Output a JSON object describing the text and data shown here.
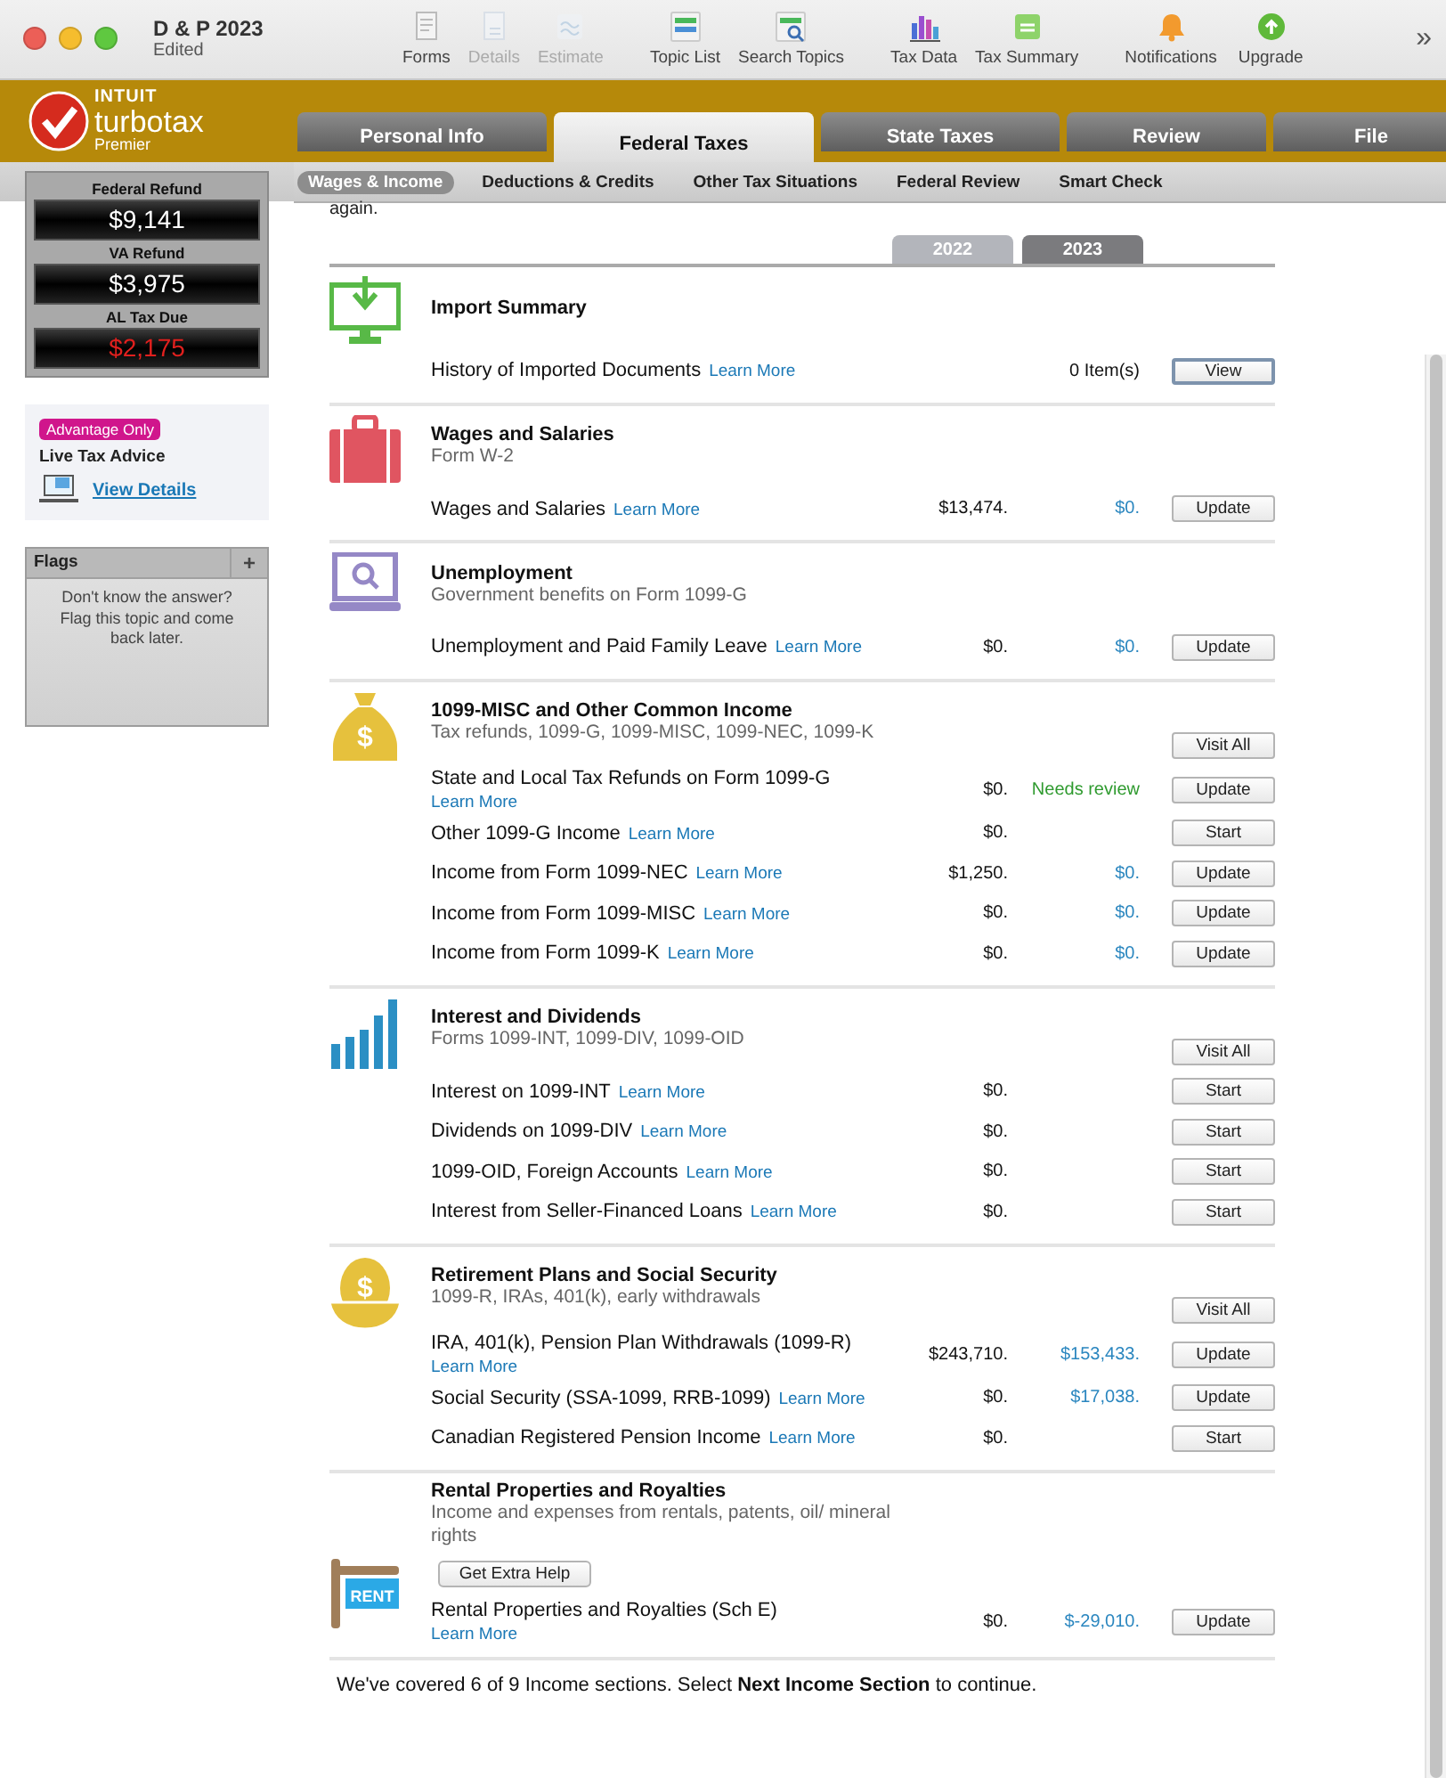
{
  "window": {
    "title": "D & P 2023",
    "subtitle": "Edited"
  },
  "toolbar": [
    {
      "label": "Forms",
      "disabled": false
    },
    {
      "label": "Details",
      "disabled": true
    },
    {
      "label": "Estimate",
      "disabled": true
    },
    {
      "label": "Topic List",
      "disabled": false
    },
    {
      "label": "Search Topics",
      "disabled": false
    },
    {
      "label": "Tax Data",
      "disabled": false
    },
    {
      "label": "Tax Summary",
      "disabled": false
    },
    {
      "label": "Notifications",
      "disabled": false
    },
    {
      "label": "Upgrade",
      "disabled": false
    }
  ],
  "toolbar_overflow": "»",
  "brand": {
    "company": "INTUIT",
    "product": "turbotax",
    "edition": "Premier"
  },
  "main_tabs": [
    {
      "label": "Personal Info",
      "selected": false
    },
    {
      "label": "Federal Taxes",
      "selected": true
    },
    {
      "label": "State Taxes",
      "selected": false
    },
    {
      "label": "Review",
      "selected": false
    },
    {
      "label": "File",
      "selected": false
    }
  ],
  "sub_tabs": [
    {
      "label": "Wages & Income",
      "selected": true
    },
    {
      "label": "Deductions & Credits",
      "selected": false
    },
    {
      "label": "Other Tax Situations",
      "selected": false
    },
    {
      "label": "Federal Review",
      "selected": false
    },
    {
      "label": "Smart Check",
      "selected": false
    }
  ],
  "refunds": [
    {
      "label": "Federal Refund",
      "amount": "$9,141",
      "kind": "refund"
    },
    {
      "label": "VA Refund",
      "amount": "$3,975",
      "kind": "refund"
    },
    {
      "label": "AL Tax Due",
      "amount": "$2,175",
      "kind": "due"
    }
  ],
  "advice_card": {
    "badge": "Advantage Only",
    "title": "Live Tax Advice",
    "link": "View Details"
  },
  "flags": {
    "title": "Flags",
    "add": "+",
    "message": "Don't know the answer? Flag this topic and come back later."
  },
  "intro_fragment": "again.",
  "year_tabs": [
    {
      "label": "2022",
      "selected": false
    },
    {
      "label": "2023",
      "selected": true
    }
  ],
  "sections": [
    {
      "title": "Import Summary",
      "rows": [
        {
          "label": "History of Imported Documents",
          "link": "Learn More",
          "current": "0 Item(s)",
          "color": "#111111",
          "button": "View",
          "focused": true
        }
      ]
    },
    {
      "title": "Wages and Salaries",
      "subtitle": "Form W-2",
      "rows": [
        {
          "label": "Wages and Salaries",
          "link": "Learn More",
          "prior": "$13,474.",
          "current": "$0.",
          "color": "#2a86bf",
          "button": "Update",
          "focused": false
        }
      ]
    },
    {
      "title": "Unemployment",
      "subtitle": "Government benefits on Form 1099-G",
      "rows": [
        {
          "label": "Unemployment and Paid Family Leave",
          "link": "Learn More",
          "prior": "$0.",
          "current": "$0.",
          "color": "#2a86bf",
          "button": "Update",
          "focused": false
        }
      ]
    },
    {
      "title": "1099-MISC and Other Common Income",
      "subtitle": "Tax refunds, 1099-G, 1099-MISC, 1099-NEC, 1099-K",
      "symbol": "$",
      "visit_all": "Visit All",
      "rows": [
        {
          "label": "State and Local Tax Refunds on Form 1099-G",
          "link": "Learn More",
          "prior": "$0.",
          "current": "Needs review",
          "color": "#2e9a2e",
          "button": "Update",
          "focused": false
        },
        {
          "label": "Other 1099-G Income",
          "link": "Learn More",
          "prior": "$0.",
          "button": "Start",
          "focused": false
        },
        {
          "label": "Income from Form 1099-NEC",
          "link": "Learn More",
          "prior": "$1,250.",
          "current": "$0.",
          "color": "#2a86bf",
          "button": "Update",
          "focused": false
        },
        {
          "label": "Income from Form 1099-MISC",
          "link": "Learn More",
          "prior": "$0.",
          "current": "$0.",
          "color": "#2a86bf",
          "button": "Update",
          "focused": false
        },
        {
          "label": "Income from Form 1099-K",
          "link": "Learn More",
          "prior": "$0.",
          "current": "$0.",
          "color": "#2a86bf",
          "button": "Update",
          "focused": false
        }
      ]
    },
    {
      "title": "Interest and Dividends",
      "subtitle": "Forms 1099-INT, 1099-DIV, 1099-OID",
      "visit_all": "Visit All",
      "rows": [
        {
          "label": "Interest on 1099-INT",
          "link": "Learn More",
          "prior": "$0.",
          "button": "Start",
          "focused": false
        },
        {
          "label": "Dividends on 1099-DIV",
          "link": "Learn More",
          "prior": "$0.",
          "button": "Start",
          "focused": false
        },
        {
          "label": "1099-OID, Foreign Accounts",
          "link": "Learn More",
          "prior": "$0.",
          "button": "Start",
          "focused": false
        },
        {
          "label": "Interest from Seller-Financed Loans",
          "link": "Learn More",
          "prior": "$0.",
          "button": "Start",
          "focused": false
        }
      ]
    },
    {
      "title": "Retirement Plans and Social Security",
      "subtitle": "1099-R, IRAs, 401(k), early withdrawals",
      "symbol": "$",
      "visit_all": "Visit All",
      "rows": [
        {
          "label": "IRA, 401(k), Pension Plan Withdrawals (1099-R)",
          "link": "Learn More",
          "prior": "$243,710.",
          "current": "$153,433.",
          "color": "#2a86bf",
          "button": "Update",
          "focused": false
        },
        {
          "label": "Social Security (SSA-1099, RRB-1099)",
          "link": "Learn More",
          "prior": "$0.",
          "current": "$17,038.",
          "color": "#2a86bf",
          "button": "Update",
          "focused": false
        },
        {
          "label": "Canadian Registered Pension Income",
          "link": "Learn More",
          "prior": "$0.",
          "button": "Start",
          "focused": false
        }
      ]
    },
    {
      "title": "Rental Properties and Royalties",
      "subtitle": "Income and expenses from rentals, patents, oil/ mineral rights",
      "extra_help": "Get Extra Help",
      "sign_text": "RENT",
      "rows": [
        {
          "label": "Rental Properties and Royalties (Sch E)",
          "link": "Learn More",
          "prior": "$0.",
          "current": "$-29,010.",
          "color": "#2a86bf",
          "button": "Update",
          "focused": false
        }
      ]
    }
  ],
  "footer": "We've covered 6 of 9 Income sections. Select **Next Income Section** to continue."
}
